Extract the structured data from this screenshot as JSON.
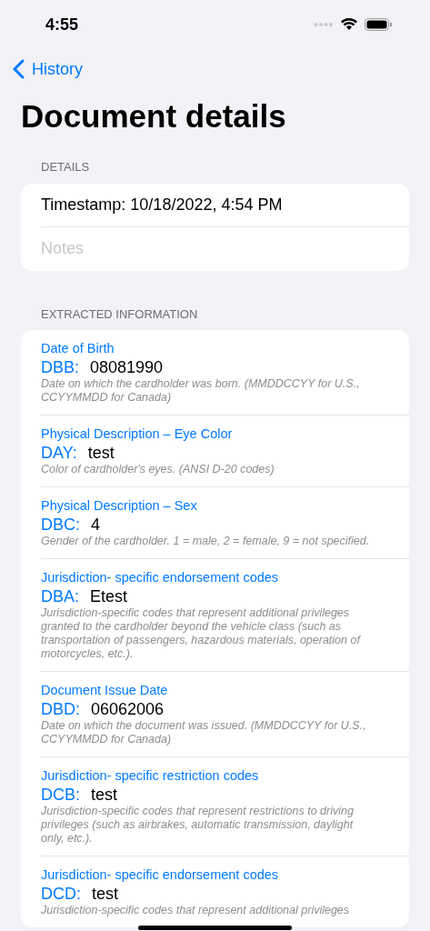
{
  "status_bar": {
    "time": "4:55"
  },
  "nav": {
    "back": "History",
    "title": "Document details"
  },
  "details": {
    "header": "DETAILS",
    "timestamp": "Timestamp: 10/18/2022, 4:54 PM",
    "notes": {
      "placeholder": "Notes"
    }
  },
  "extracted": {
    "header": "EXTRACTED INFORMATION",
    "items": [
      {
        "title": "Date of Birth",
        "code": "DBB:",
        "value": "08081990",
        "description": "Date on which the cardholder was born. (MMDDCCYY for U.S., CCYYMMDD for Canada)"
      },
      {
        "title": "Physical Description – Eye Color",
        "code": "DAY:",
        "value": "test",
        "description": "Color of cardholder's eyes. (ANSI D-20 codes)"
      },
      {
        "title": "Physical Description – Sex",
        "code": "DBC:",
        "value": "4",
        "description": "Gender of the cardholder. 1 = male, 2 = female, 9 = not specified."
      },
      {
        "title": "Jurisdiction- specific endorsement codes",
        "code": "DBA:",
        "value": "Etest",
        "description": "Jurisdiction-specific codes that represent additional privileges granted to the cardholder beyond the vehicle class (such as transportation of passengers, hazardous materials, operation of motorcycles, etc.)."
      },
      {
        "title": "Document Issue Date",
        "code": "DBD:",
        "value": "06062006",
        "description": "Date on which the document was issued. (MMDDCCYY for U.S., CCYYMMDD for Canada)"
      },
      {
        "title": "Jurisdiction- specific restriction codes",
        "code": "DCB:",
        "value": "test",
        "description": "Jurisdiction-specific codes that represent restrictions to driving privileges (such as airbrakes, automatic transmission, daylight only, etc.)."
      },
      {
        "title": "Jurisdiction- specific endorsement codes",
        "code": "DCD:",
        "value": "test",
        "description": "Jurisdiction-specific codes that represent additional privileges"
      }
    ]
  }
}
